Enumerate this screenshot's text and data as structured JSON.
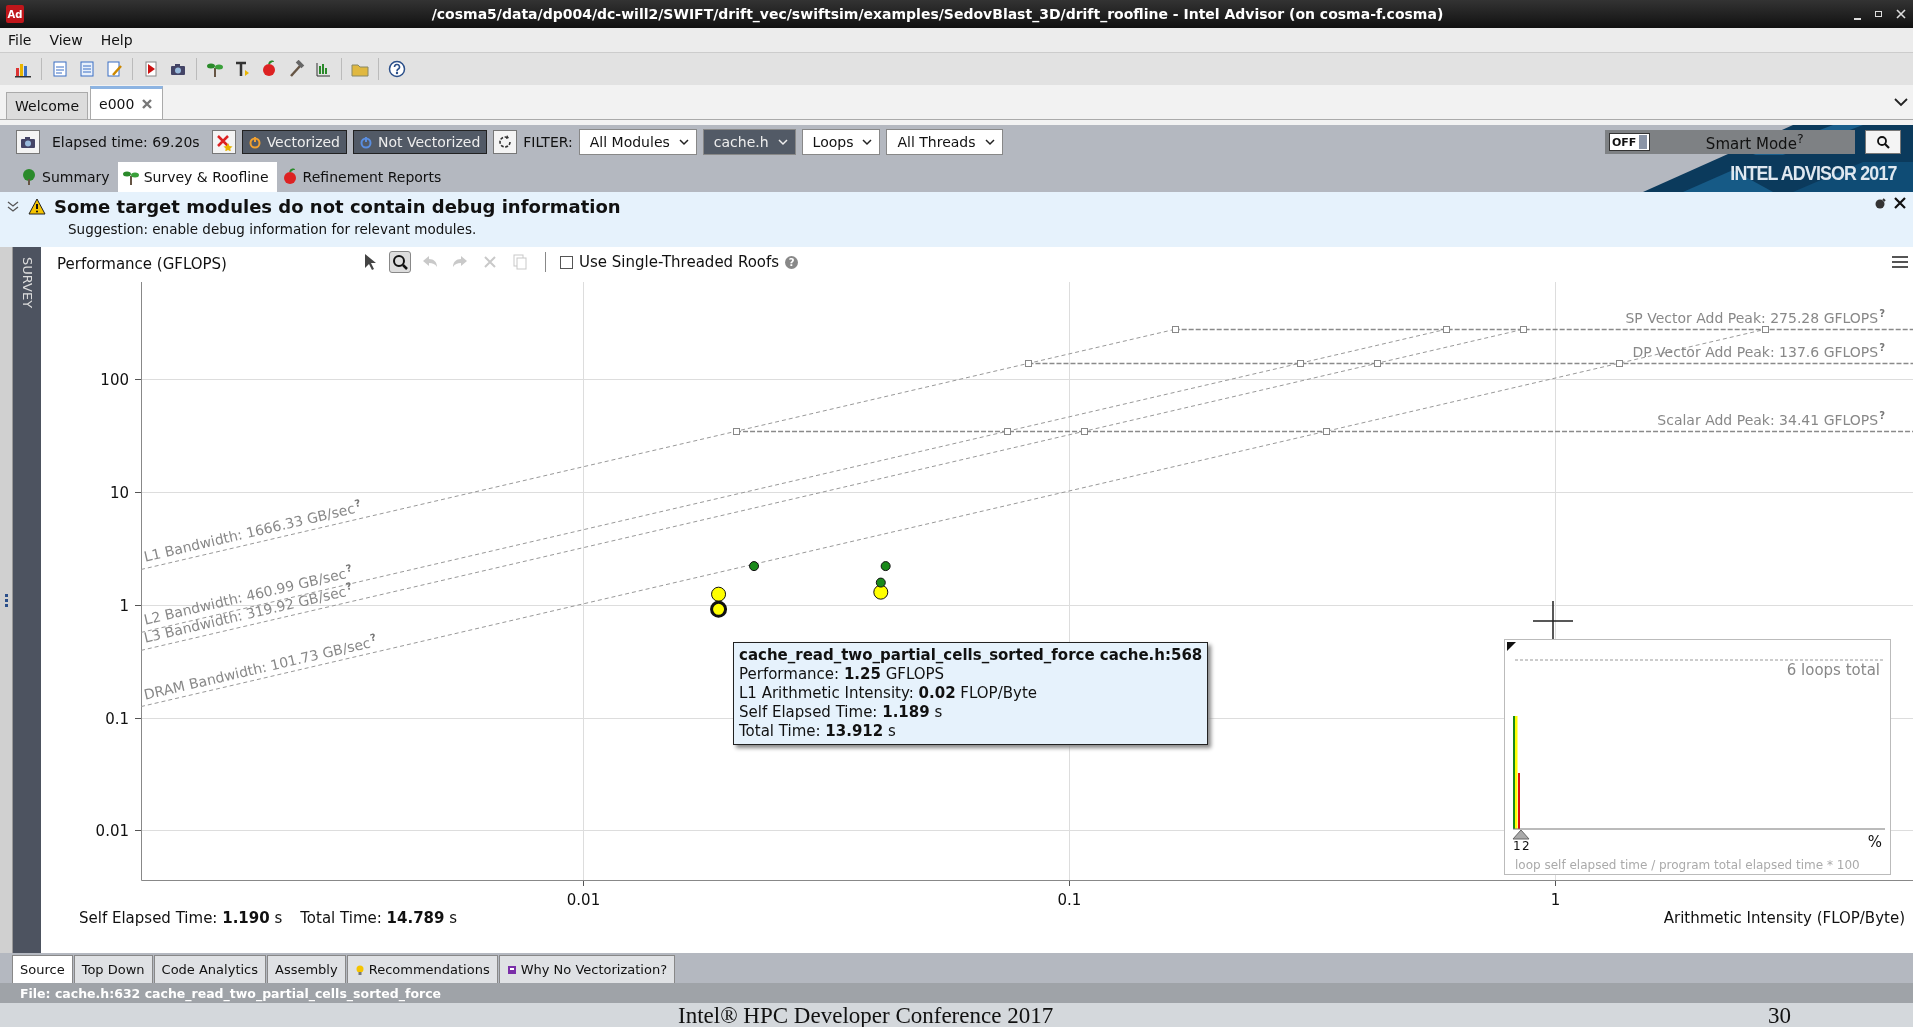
{
  "window": {
    "app_icon": "Ad",
    "title": "/cosma5/data/dp004/dc-will2/SWIFT/drift_vec/swiftsim/examples/SedovBlast_3D/drift_roofline - Intel Advisor (on cosma-f.cosma)"
  },
  "menu": [
    "File",
    "View",
    "Help"
  ],
  "doc_tabs": [
    {
      "label": "Welcome",
      "selected": false,
      "closable": false
    },
    {
      "label": "e000",
      "selected": true,
      "closable": true
    }
  ],
  "filter_bar": {
    "elapsed": "Elapsed time: 69.20s",
    "toggles": [
      {
        "label": "Vectorized",
        "on": true,
        "color": "#f0a030"
      },
      {
        "label": "Not Vectorized",
        "on": true,
        "color": "#5a8ee0"
      }
    ],
    "filter_label": "FILTER:",
    "dropdowns": [
      {
        "value": "All Modules",
        "highlighted": false
      },
      {
        "value": "cache.h",
        "highlighted": true
      },
      {
        "value": "Loops",
        "highlighted": false
      },
      {
        "value": "All Threads",
        "highlighted": false
      }
    ],
    "smart_mode": {
      "switch": "OFF",
      "on": false,
      "label": "Smart Mode$^{?}$"
    },
    "brand": "INTEL ADVISOR 2017"
  },
  "view_tabs": [
    {
      "label": "Summary",
      "selected": false
    },
    {
      "label": "Survey & Roofline",
      "selected": true
    },
    {
      "label": "Refinement Reports",
      "selected": false
    }
  ],
  "warning": {
    "title": "Some target modules do not contain debug information",
    "suggestion": "Suggestion: enable debug information for relevant modules."
  },
  "sidebar": {
    "label": "SURVEY"
  },
  "chart_toolbar": {
    "tools": [
      {
        "selected": false,
        "disabled": false
      },
      {
        "selected": true,
        "disabled": false
      },
      {
        "selected": false,
        "disabled": true
      },
      {
        "selected": false,
        "disabled": true
      },
      {
        "selected": false,
        "disabled": true
      },
      {
        "selected": false,
        "disabled": true
      }
    ],
    "checkbox": {
      "label": "Use Single-Threaded Roofs",
      "checked": false,
      "help": "?"
    }
  },
  "roofline": {
    "ylabel": "Performance (GFLOPS)",
    "xlabel": "Arithmetic Intensity (FLOP/Byte)",
    "xticks": [
      "0.01",
      "0.1",
      "1"
    ],
    "yticks": [
      "100",
      "10",
      "1",
      "0.1",
      "0.01"
    ],
    "roofs": [
      {
        "kind": "peak",
        "label": "SP Vector Add Peak: 275.28 GFLOPS",
        "help": "?"
      },
      {
        "kind": "peak",
        "label": "DP Vector Add Peak: 137.6 GFLOPS",
        "help": "?"
      },
      {
        "kind": "peak",
        "label": "Scalar Add Peak: 34.41 GFLOPS",
        "help": "?"
      },
      {
        "kind": "bandwidth",
        "label": "L1 Bandwidth: 1666.33 GB/sec",
        "help": "?"
      },
      {
        "kind": "bandwidth",
        "label": "L2 Bandwidth: 460.99 GB/sec",
        "help": "?"
      },
      {
        "kind": "bandwidth",
        "label": "L3 Bandwidth: 319.92 GB/sec",
        "help": "?"
      },
      {
        "kind": "bandwidth",
        "label": "DRAM Bandwidth: 101.73 GB/sec",
        "help": "?"
      }
    ],
    "loops": [
      {
        "color": "#ffff00",
        "kind": "large",
        "selected": false
      },
      {
        "color": "#ffff00",
        "kind": "large",
        "selected": true
      },
      {
        "color": "#ffff00",
        "kind": "large",
        "selected": false
      },
      {
        "color": "#1a8a1a",
        "kind": "small",
        "selected": false
      },
      {
        "color": "#1a8a1a",
        "kind": "small",
        "selected": false
      },
      {
        "color": "#1a8a1a",
        "kind": "small",
        "selected": false
      }
    ],
    "tooltip": {
      "title": "cache_read_two_partial_cells_sorted_force cache.h:568",
      "lines": [
        "Performance: **1.25** GFLOPS",
        "L1 Arithmetic Intensity: **0.02** FLOP/Byte",
        "Self Elapsed Time: **1.189** s",
        "Total Time: **13.912** s"
      ]
    },
    "histogram": {
      "total": "6 loops total",
      "ticks": [
        "1",
        "2"
      ],
      "unit": "%",
      "caption": "loop self elapsed time / program total elapsed time * 100"
    }
  },
  "stats": [
    "Self Elapsed Time: **1.190** s",
    "Total Time: **14.789** s"
  ],
  "bottom_tabs": [
    {
      "label": "Source",
      "selected": true
    },
    {
      "label": "Top Down",
      "selected": false
    },
    {
      "label": "Code Analytics",
      "selected": false
    },
    {
      "label": "Assembly",
      "selected": false
    },
    {
      "label": "Recommendations",
      "selected": false
    },
    {
      "label": "Why No Vectorization?",
      "selected": false
    }
  ],
  "file_bar": "File: cache.h:632 cache_read_two_partial_cells_sorted_force",
  "slide_footer": {
    "title": "Intel® HPC Developer Conference 2017",
    "page": "30"
  }
}
